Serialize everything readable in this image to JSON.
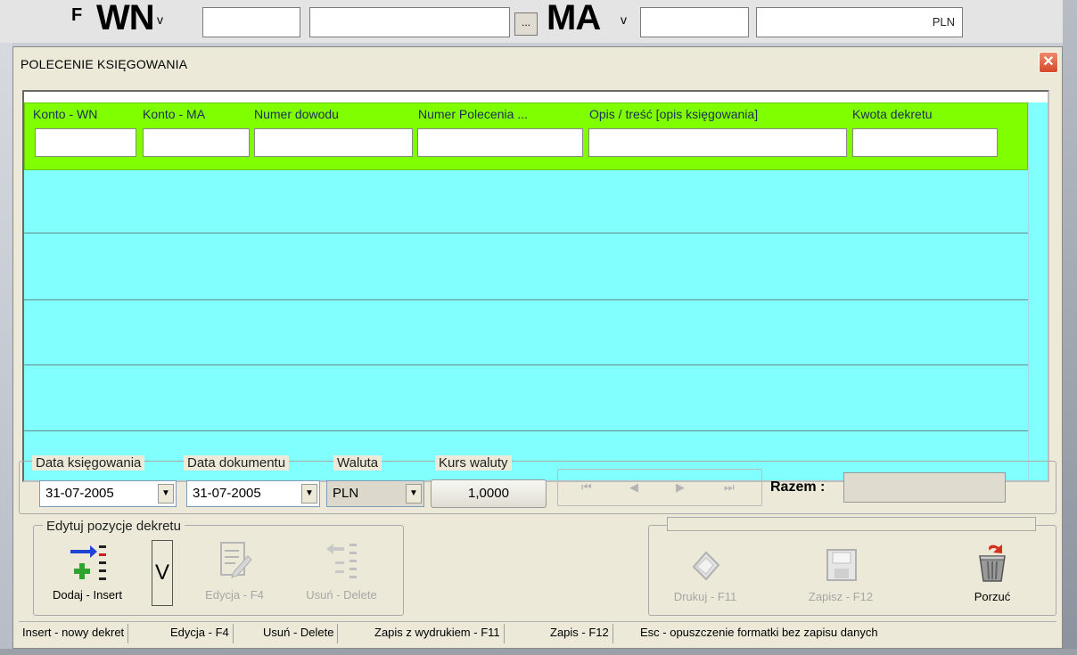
{
  "background": {
    "f_label": "F",
    "wn_label": "WN",
    "ma_label": "MA",
    "v_mark": "v",
    "browse_label": "...",
    "currency": "PLN"
  },
  "dialog": {
    "title": "POLECENIE KSIĘGOWANIA",
    "close_icon": "close-icon"
  },
  "grid": {
    "columns": [
      {
        "label": "Konto - WN",
        "value": ""
      },
      {
        "label": "Konto - MA",
        "value": ""
      },
      {
        "label": "Numer dowodu",
        "value": ""
      },
      {
        "label": "Numer Polecenia ...",
        "value": ""
      },
      {
        "label": "Opis / treść [opis księgowania]",
        "value": ""
      },
      {
        "label": "Kwota dekretu",
        "value": ""
      }
    ],
    "colors": {
      "header": "#80ff00",
      "rows": "#80fffe"
    }
  },
  "params": {
    "data_ksiegowania_label": "Data księgowania",
    "data_ksiegowania": "31-07-2005",
    "data_dokumentu_label": "Data dokumentu",
    "data_dokumentu": "31-07-2005",
    "waluta_label": "Waluta",
    "waluta": "PLN",
    "kurs_label": "Kurs waluty",
    "kurs": "1,0000",
    "razem_label": "Razem :",
    "razem": "",
    "nav": [
      "⏮",
      "◀",
      "▶",
      "⏭"
    ]
  },
  "edit_group": {
    "label": "Edytuj  pozycje dekretu",
    "add_label": "Dodaj - Insert",
    "v_label": "V",
    "edit_label": "Edycja - F4",
    "delete_label": "Usuń - Delete"
  },
  "actions": {
    "print_label": "Drukuj - F11",
    "save_label": "Zapisz - F12",
    "cancel_label": "Porzuć"
  },
  "statusbar": [
    "Insert - nowy dekret",
    "Edycja - F4",
    "Usuń - Delete",
    "Zapis z wydrukiem - F11",
    "Zapis - F12",
    "Esc - opuszczenie formatki bez zapisu danych"
  ]
}
